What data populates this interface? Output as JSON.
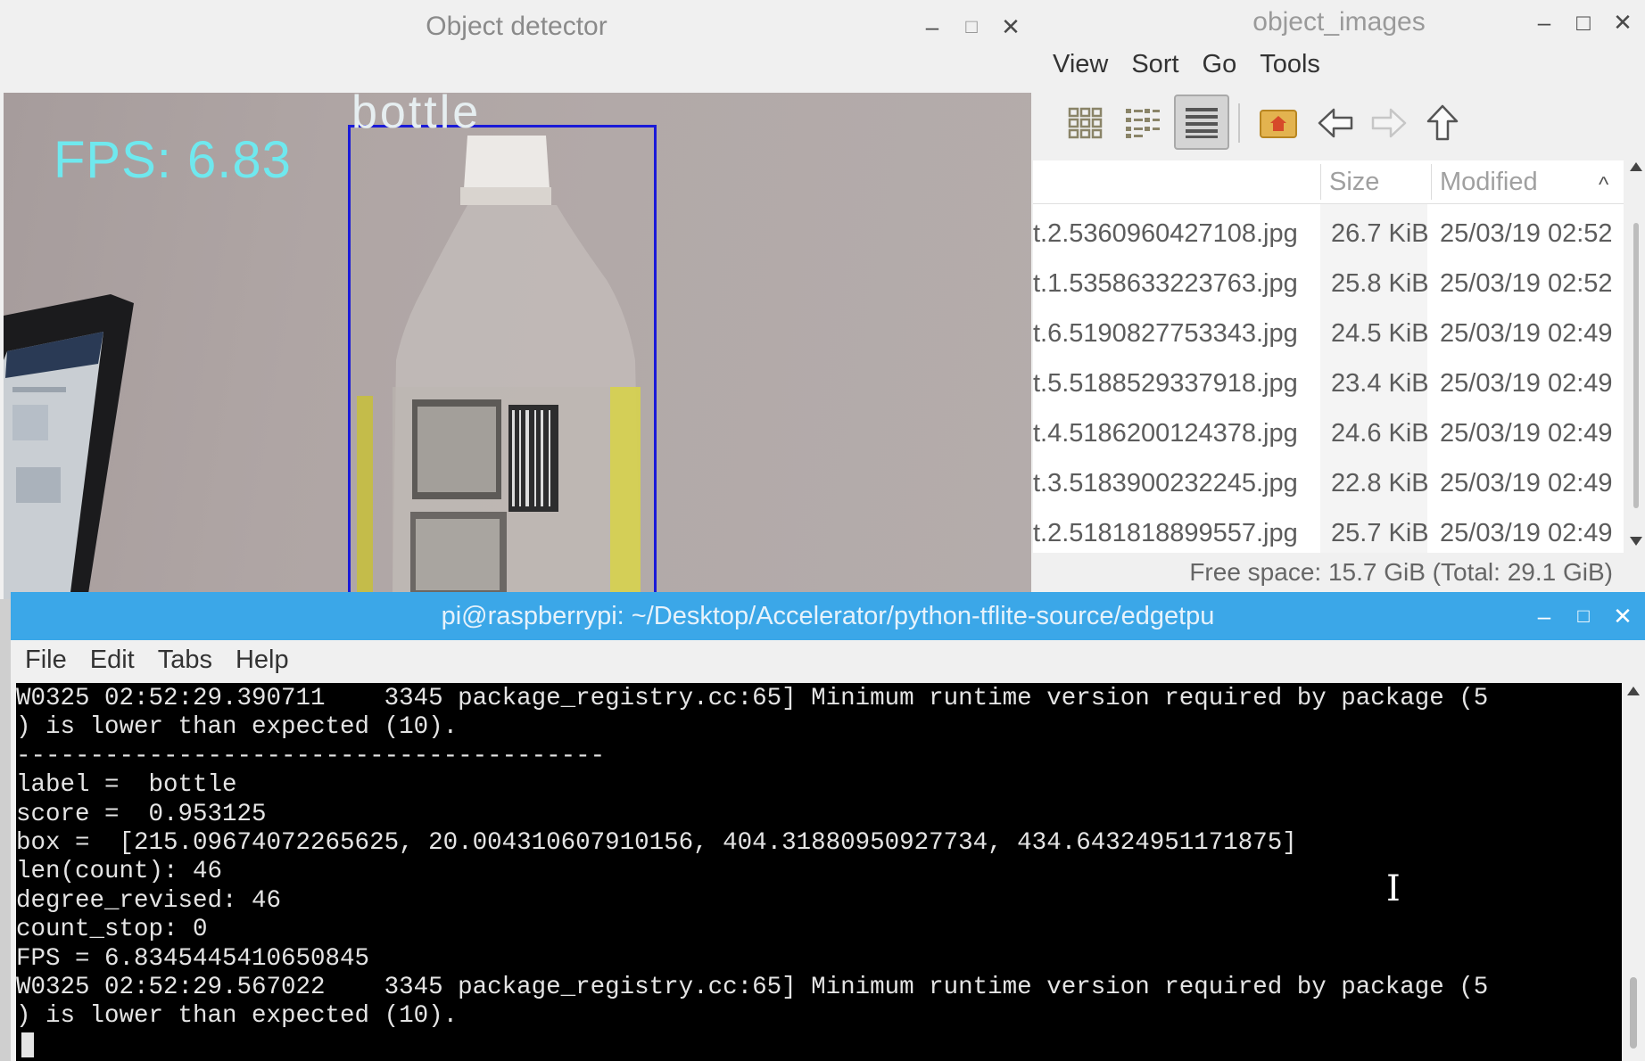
{
  "detector": {
    "title": "Object detector",
    "controls": {
      "minimize": "–",
      "maximize": "□",
      "close": "✕"
    },
    "fps_overlay": "FPS: 6.83",
    "detection_label": "bottle",
    "box_color": "#1a1ad8",
    "fps_color": "#6fe8ee"
  },
  "file_manager": {
    "title": "object_images",
    "controls": {
      "minimize": "–",
      "maximize": "□",
      "close": "✕"
    },
    "menu": [
      "View",
      "Sort",
      "Go",
      "Tools"
    ],
    "toolbar_icons": [
      "icon-view-icon",
      "thumbnail-view-icon",
      "compact-view-icon",
      "detailed-list-view-icon",
      "home-folder-icon",
      "back-arrow-icon",
      "forward-arrow-icon",
      "up-arrow-icon"
    ],
    "columns": {
      "size": "Size",
      "modified": "Modified",
      "sort_indicator": "^"
    },
    "files": [
      {
        "name": "t.2.5360960427108.jpg",
        "size": "26.7 KiB",
        "modified": "25/03/19 02:52"
      },
      {
        "name": "t.1.5358633223763.jpg",
        "size": "25.8 KiB",
        "modified": "25/03/19 02:52"
      },
      {
        "name": "t.6.5190827753343.jpg",
        "size": "24.5 KiB",
        "modified": "25/03/19 02:49"
      },
      {
        "name": "t.5.5188529337918.jpg",
        "size": "23.4 KiB",
        "modified": "25/03/19 02:49"
      },
      {
        "name": "t.4.5186200124378.jpg",
        "size": "24.6 KiB",
        "modified": "25/03/19 02:49"
      },
      {
        "name": "t.3.5183900232245.jpg",
        "size": "22.8 KiB",
        "modified": "25/03/19 02:49"
      },
      {
        "name": "t.2.5181818899557.jpg",
        "size": "25.7 KiB",
        "modified": "25/03/19 02:49"
      }
    ],
    "status": "Free space: 15.7 GiB (Total: 29.1 GiB)"
  },
  "terminal": {
    "title": "pi@raspberrypi: ~/Desktop/Accelerator/python-tflite-source/edgetpu",
    "controls": {
      "minimize": "–",
      "maximize": "□",
      "close": "✕"
    },
    "menu": [
      "File",
      "Edit",
      "Tabs",
      "Help"
    ],
    "lines": [
      "W0325 02:52:29.390711    3345 package_registry.cc:65] Minimum runtime version required by package (5",
      ") is lower than expected (10).",
      "----------------------------------------",
      "label =  bottle",
      "score =  0.953125",
      "box =  [215.09674072265625, 20.004310607910156, 404.31880950927734, 434.64324951171875]",
      "len(count): 46",
      "degree_revised: 46",
      "count_stop: 0",
      "FPS = 6.8345445410650845",
      "W0325 02:52:29.567022    3345 package_registry.cc:65] Minimum runtime version required by package (5",
      ") is lower than expected (10)."
    ],
    "accent": "#3ba7e8"
  }
}
